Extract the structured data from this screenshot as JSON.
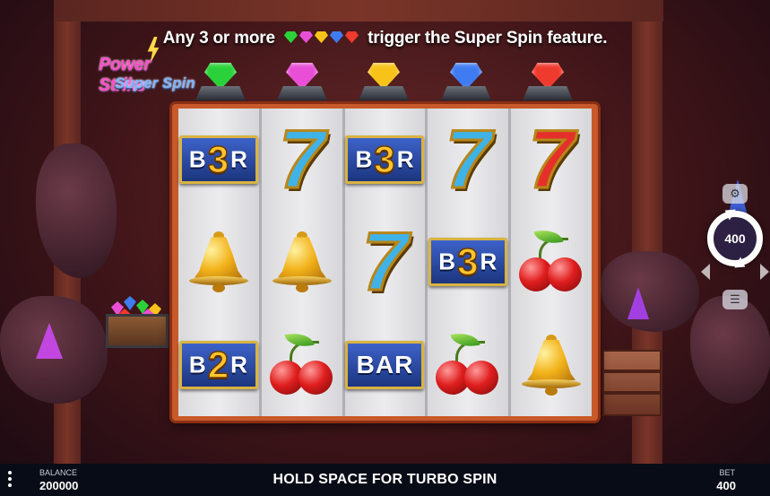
{
  "instructions": {
    "before_gems": "Any 3 or more",
    "after_gems": "trigger the Super Spin feature."
  },
  "logo": {
    "line1": "Power Strike",
    "line2": "Super Spin"
  },
  "top_gems": [
    {
      "name": "green-gem",
      "color": "#2bd13a"
    },
    {
      "name": "pink-gem",
      "color": "#e84fd6"
    },
    {
      "name": "yellow-gem",
      "color": "#f7c31a"
    },
    {
      "name": "blue-gem",
      "color": "#3f7cf2"
    },
    {
      "name": "red-gem",
      "color": "#ef3a2e"
    }
  ],
  "reels": [
    [
      {
        "type": "bar-mult",
        "left": "B",
        "mult": "3",
        "right": "R"
      },
      {
        "type": "bell"
      },
      {
        "type": "bar-mult",
        "left": "B",
        "mult": "2",
        "right": "R"
      }
    ],
    [
      {
        "type": "seven-blue",
        "text": "7"
      },
      {
        "type": "bell"
      },
      {
        "type": "cherry"
      }
    ],
    [
      {
        "type": "bar-mult",
        "left": "B",
        "mult": "3",
        "right": "R"
      },
      {
        "type": "seven-blue",
        "text": "7"
      },
      {
        "type": "bar",
        "text": "BAR"
      }
    ],
    [
      {
        "type": "seven-blue",
        "text": "7"
      },
      {
        "type": "bar-mult",
        "left": "B",
        "mult": "3",
        "right": "R"
      },
      {
        "type": "cherry"
      }
    ],
    [
      {
        "type": "seven-red",
        "text": "7"
      },
      {
        "type": "cherry"
      },
      {
        "type": "bell"
      }
    ]
  ],
  "spin": {
    "bet_display": "400"
  },
  "bottom_bar": {
    "balance_label": "BALANCE",
    "balance_value": "200000",
    "message": "HOLD SPACE FOR TURBO SPIN",
    "bet_label": "BET",
    "bet_value": "400"
  }
}
